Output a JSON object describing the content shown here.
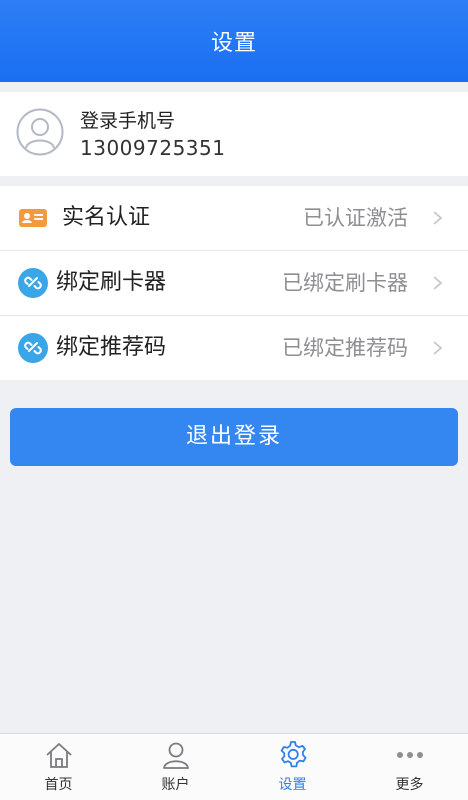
{
  "header": {
    "title": "设置"
  },
  "profile": {
    "label": "登录手机号",
    "phone": "13009725351"
  },
  "menu": [
    {
      "label": "实名认证",
      "value": "已认证激活",
      "icon": "id-card-icon"
    },
    {
      "label": "绑定刷卡器",
      "value": "已绑定刷卡器",
      "icon": "link-icon"
    },
    {
      "label": "绑定推荐码",
      "value": "已绑定推荐码",
      "icon": "link-icon"
    }
  ],
  "logout_label": "退出登录",
  "tabs": [
    {
      "label": "首页",
      "icon": "home-icon",
      "active": false
    },
    {
      "label": "账户",
      "icon": "user-icon",
      "active": false
    },
    {
      "label": "设置",
      "icon": "gear-icon",
      "active": true
    },
    {
      "label": "更多",
      "icon": "more-icon",
      "active": false
    }
  ],
  "colors": {
    "header": "#1a6ff2",
    "accent": "#2f80ed",
    "button": "#3487f0",
    "id_card": "#f39b3c",
    "link": "#3aa6e8"
  }
}
